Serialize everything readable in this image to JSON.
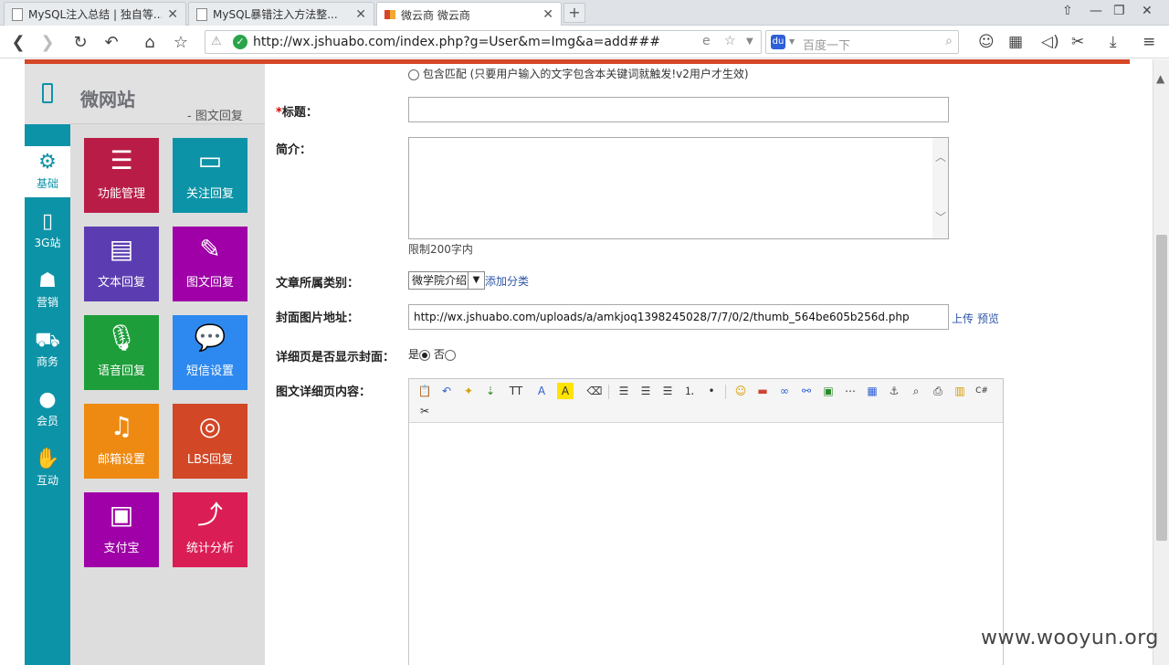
{
  "browser": {
    "tabs": [
      {
        "label": "MySQL注入总结 | 独自等..."
      },
      {
        "label": "MySQL暴错注入方法整..."
      },
      {
        "label": "微云商 微云商"
      }
    ],
    "url": "http://wx.jshuabo.com/index.php?g=User&m=Img&a=add###",
    "search_placeholder": "百度一下"
  },
  "sidebar": {
    "site_title": "微网站",
    "breadcrumb": "- 图文回复",
    "categories": [
      {
        "label": "基础",
        "icon": "gear-icon",
        "active": true
      },
      {
        "label": "3G站",
        "icon": "phone-icon"
      },
      {
        "label": "营销",
        "icon": "people-icon"
      },
      {
        "label": "商务",
        "icon": "cart-icon"
      },
      {
        "label": "会员",
        "icon": "user-icon"
      },
      {
        "label": "互动",
        "icon": "handshake-icon"
      }
    ],
    "tiles": [
      {
        "label": "功能管理",
        "icon": "notepad-icon",
        "color": "#b91d47"
      },
      {
        "label": "关注回复",
        "icon": "speech-bubble-icon",
        "color": "#0d93a7"
      },
      {
        "label": "文本回复",
        "icon": "document-icon",
        "color": "#5c3db1"
      },
      {
        "label": "图文回复",
        "icon": "edit-icon",
        "color": "#9f00a7"
      },
      {
        "label": "语音回复",
        "icon": "microphone-icon",
        "color": "#1e9e3a"
      },
      {
        "label": "短信设置",
        "icon": "chat-icon",
        "color": "#2d89ef"
      },
      {
        "label": "邮箱设置",
        "icon": "music-icon",
        "color": "#ee8a12"
      },
      {
        "label": "LBS回复",
        "icon": "compass-icon",
        "color": "#d24726"
      },
      {
        "label": "支付宝",
        "icon": "image-icon",
        "color": "#9f00a7"
      },
      {
        "label": "统计分析",
        "icon": "chart-icon",
        "color": "#da1e55"
      }
    ]
  },
  "form": {
    "match_option": "包含匹配 (只要用户输入的文字包含本关键词就触发!v2用户才生效)",
    "title_label": "标题：",
    "title_required": "*",
    "title_value": "",
    "intro_label": "简介：",
    "intro_hint": "限制200字内",
    "category_label": "文章所属类别：",
    "category_selected": "微学院介绍",
    "add_category_link": "添加分类",
    "cover_label": "封面图片地址：",
    "cover_value": "http://wx.jshuabo.com/uploads/a/amkjoq1398245028/7/7/0/2/thumb_564be605b256d.php",
    "upload_link": "上传",
    "preview_link": "预览",
    "show_cover_label": "详细页是否显示封面：",
    "show_cover_yes": "是",
    "show_cover_no": "否",
    "show_cover_value": "是",
    "content_label": "图文详细页内容："
  },
  "watermark": "www.wooyun.org"
}
